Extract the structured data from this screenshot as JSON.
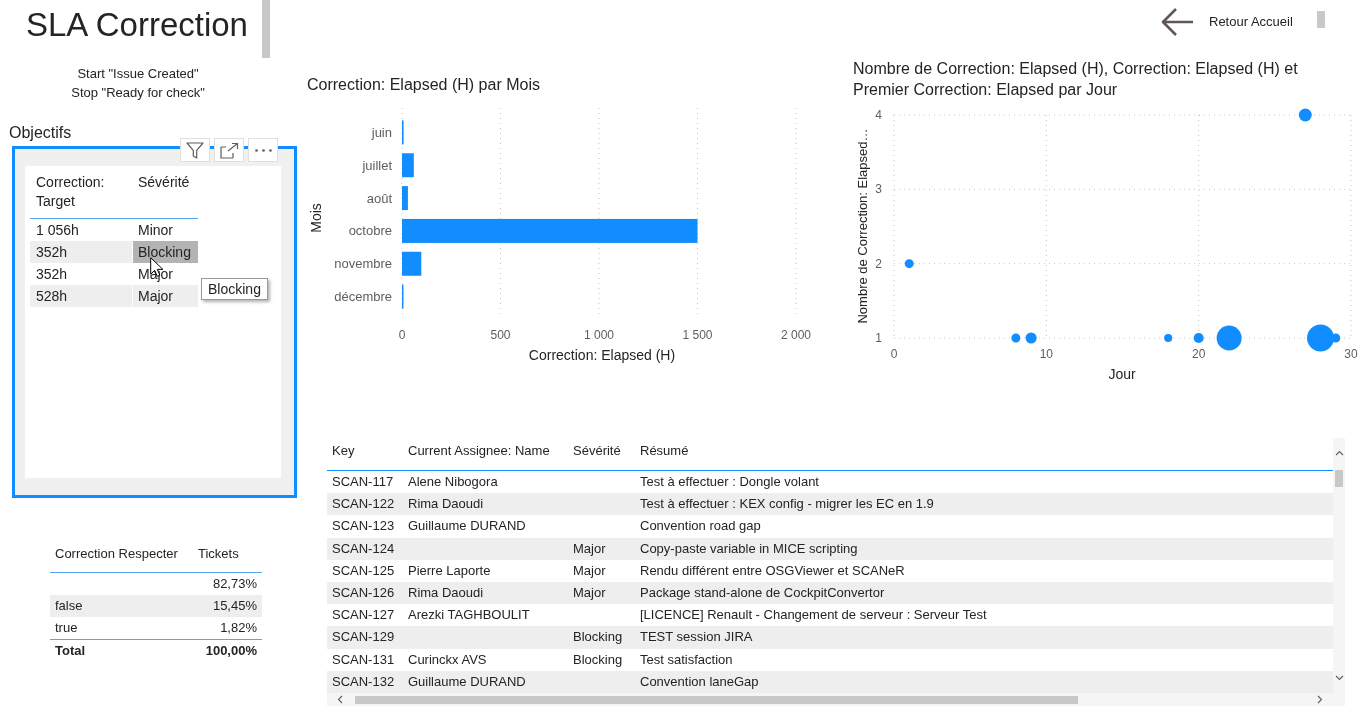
{
  "header": {
    "title": "SLA Correction",
    "subtitle_lines": [
      "Start \"Issue Created\"",
      "Stop \"Ready for check\""
    ],
    "back_button": {
      "label": "Retour Accueil"
    }
  },
  "objectifs": {
    "title": "Objectifs",
    "selected": true,
    "columns": [
      "Correction: Target",
      "Sévérité"
    ],
    "rows": [
      {
        "target": "1 056h",
        "severity": "Minor",
        "hovered": false
      },
      {
        "target": "352h",
        "severity": "Blocking",
        "hovered": true
      },
      {
        "target": "352h",
        "severity": "Major",
        "hovered": false
      },
      {
        "target": "528h",
        "severity": "Major",
        "hovered": false
      }
    ],
    "tooltip": {
      "text": "Blocking"
    }
  },
  "bar_chart": {
    "chart_data": {
      "type": "bar",
      "orientation": "horizontal",
      "title": "Correction: Elapsed (H) par Mois",
      "xlabel": "Correction: Elapsed (H)",
      "ylabel": "Mois",
      "categories": [
        "juin",
        "juillet",
        "août",
        "octobre",
        "novembre",
        "décembre"
      ],
      "values": [
        8,
        60,
        30,
        1500,
        98,
        5
      ],
      "xlim": [
        0,
        2000
      ],
      "xticks": [
        0,
        500,
        {
          "value": 1000,
          "label": "1 000"
        },
        {
          "value": 1500,
          "label": "1 500"
        },
        {
          "value": 2000,
          "label": "2 000"
        }
      ],
      "grid": true
    }
  },
  "scatter_chart": {
    "chart_data": {
      "type": "scatter",
      "title": "Nombre de Correction: Elapsed (H), Correction: Elapsed (H) et Premier Correction: Elapsed par Jour",
      "xlabel": "Jour",
      "ylabel": "Nombre de Correction: Elapsed…",
      "x": [
        1,
        8,
        9,
        18,
        20,
        22,
        27,
        28,
        29
      ],
      "values": [
        2,
        1,
        1,
        1,
        1,
        1,
        4,
        1,
        1
      ],
      "sizes": [
        0.11,
        0.11,
        0.17,
        0.09,
        0.14,
        0.86,
        0.23,
        1,
        0.11
      ],
      "xlim": [
        0,
        30
      ],
      "ylim": [
        1,
        4
      ],
      "xticks": [
        0,
        10,
        20,
        30
      ],
      "yticks": [
        1,
        2,
        3,
        4
      ],
      "grid": true
    }
  },
  "respect_table": {
    "columns": [
      "Correction Respecter",
      "Tickets"
    ],
    "rows": [
      {
        "value": "82,73%"
      },
      {
        "label": "false",
        "value": "15,45%"
      },
      {
        "label": "true",
        "value": "1,82%"
      }
    ],
    "total": {
      "label": "Total",
      "value": "100,00%"
    }
  },
  "issues_table": {
    "columns": [
      "Key",
      "Current Assignee: Name",
      "Sévérité",
      "Résumé"
    ],
    "rows": [
      {
        "key": "SCAN-117",
        "assignee": "Alene Nibogora",
        "summary": "Test à effectuer : Dongle volant"
      },
      {
        "key": "SCAN-122",
        "assignee": "Rima Daoudi",
        "summary": "Test à effectuer : KEX config - migrer les EC en 1.9"
      },
      {
        "key": "SCAN-123",
        "assignee": "Guillaume DURAND",
        "summary": "Convention road gap"
      },
      {
        "key": "SCAN-124",
        "severity": "Major",
        "summary": "Copy-paste variable in MICE scripting"
      },
      {
        "key": "SCAN-125",
        "assignee": "Pierre Laporte",
        "severity": "Major",
        "summary": "Rendu différent entre OSGViewer et SCANeR"
      },
      {
        "key": "SCAN-126",
        "assignee": "Rima Daoudi",
        "severity": "Major",
        "summary": "Package stand-alone de CockpitConvertor"
      },
      {
        "key": "SCAN-127",
        "assignee": "Arezki TAGHBOULIT",
        "summary": "[LICENCE] Renault - Changement de serveur : Serveur Test"
      },
      {
        "key": "SCAN-129",
        "severity": "Blocking",
        "summary": "TEST session JIRA"
      },
      {
        "key": "SCAN-131",
        "assignee": "Curinckx AVS",
        "severity": "Blocking",
        "summary": "Test satisfaction"
      },
      {
        "key": "SCAN-132",
        "assignee": "Guillaume DURAND",
        "summary": "Convention laneGap"
      }
    ]
  }
}
